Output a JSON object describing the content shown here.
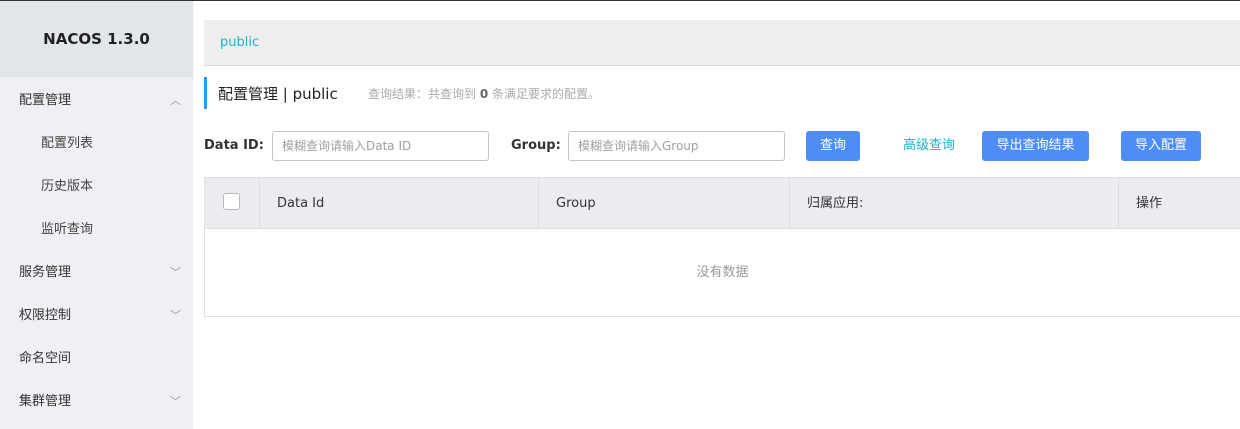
{
  "app": {
    "title": "NACOS 1.3.0"
  },
  "sidebar": {
    "items": [
      {
        "label": "配置管理",
        "chevron": "︿"
      },
      {
        "label": "配置列表"
      },
      {
        "label": "历史版本"
      },
      {
        "label": "监听查询"
      },
      {
        "label": "服务管理",
        "chevron": "﹀"
      },
      {
        "label": "权限控制",
        "chevron": "﹀"
      },
      {
        "label": "命名空间"
      },
      {
        "label": "集群管理",
        "chevron": "﹀"
      }
    ]
  },
  "namespace_bar": {
    "active": "public"
  },
  "page": {
    "title": "配置管理 | public",
    "result_prefix": "查询结果：共查询到 ",
    "result_count": "0",
    "result_suffix": " 条满足要求的配置。"
  },
  "search": {
    "data_id_label": "Data ID:",
    "data_id_placeholder": "模糊查询请输入Data ID",
    "data_id_value": "",
    "group_label": "Group:",
    "group_placeholder": "模糊查询请输入Group",
    "group_value": "",
    "query_label": "查询",
    "advanced_label": "高级查询",
    "export_label": "导出查询结果",
    "import_label": "导入配置"
  },
  "table": {
    "columns": [
      "Data Id",
      "Group",
      "归属应用:",
      "操作"
    ],
    "empty_text": "没有数据",
    "rows": []
  },
  "colors": {
    "accent": "#209bfa",
    "primary_button": "#4d8df5",
    "link": "#1fb2d4",
    "sidebar_bg": "#eef0f3"
  }
}
